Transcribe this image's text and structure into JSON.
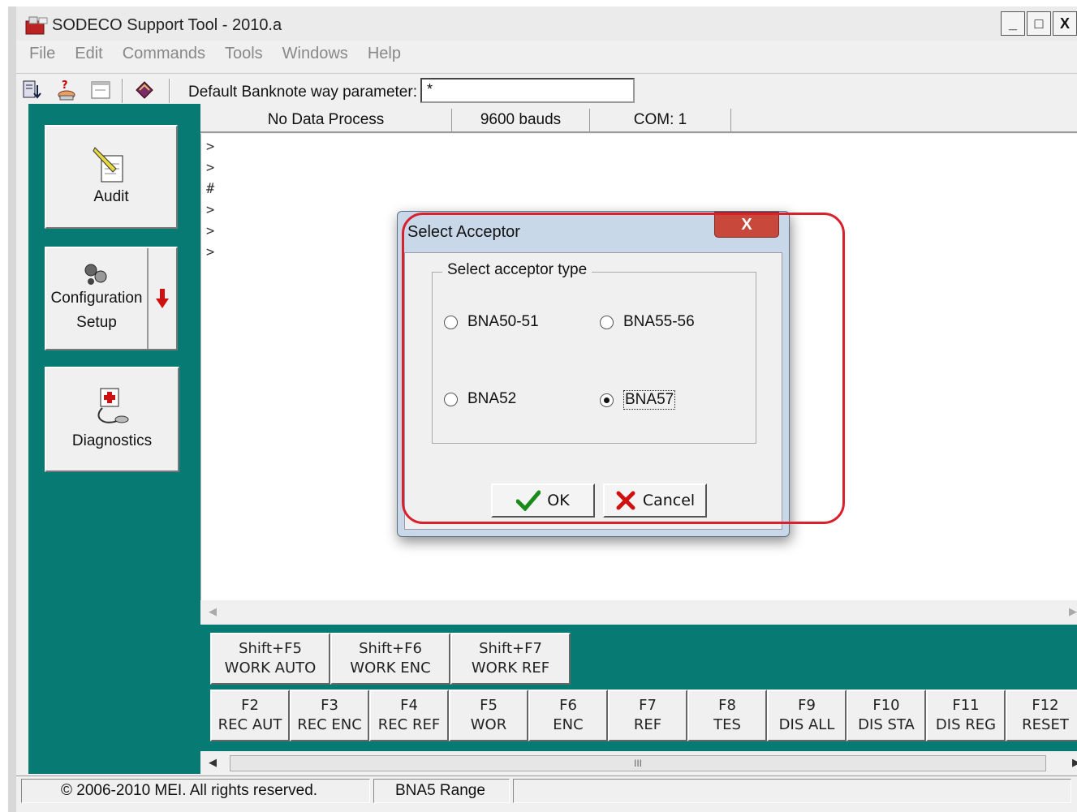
{
  "window": {
    "title": "SODECO Support Tool - 2010.a",
    "controls": [
      "_",
      "□",
      "X"
    ]
  },
  "menu": [
    "File",
    "Edit",
    "Commands",
    "Tools",
    "Windows",
    "Help"
  ],
  "toolbar": {
    "param_label": "Default Banknote way parameter:",
    "param_value": "*"
  },
  "sidebar": {
    "audit_label": "Audit",
    "config_label_1": "Configuration",
    "config_label_2": "Setup",
    "diagnostics_label": "Diagnostics"
  },
  "status_strip": {
    "process": "No Data Process",
    "bauds": "9600 bauds",
    "com": "COM: 1"
  },
  "console": {
    "lines": [
      ">",
      ">",
      "#",
      ">",
      ">",
      ">"
    ]
  },
  "fkeys_row1": [
    {
      "key": "Shift+F5",
      "label": "WORK AUTO"
    },
    {
      "key": "Shift+F6",
      "label": "WORK ENC"
    },
    {
      "key": "Shift+F7",
      "label": "WORK REF"
    }
  ],
  "fkeys_row2": [
    {
      "key": "F2",
      "label": "REC AUT"
    },
    {
      "key": "F3",
      "label": "REC ENC"
    },
    {
      "key": "F4",
      "label": "REC REF"
    },
    {
      "key": "F5",
      "label": "WOR"
    },
    {
      "key": "F6",
      "label": "ENC"
    },
    {
      "key": "F7",
      "label": "REF"
    },
    {
      "key": "F8",
      "label": "TES"
    },
    {
      "key": "F9",
      "label": "DIS ALL"
    },
    {
      "key": "F10",
      "label": "DIS STA"
    },
    {
      "key": "F11",
      "label": "DIS REG"
    },
    {
      "key": "F12",
      "label": "RESET"
    }
  ],
  "scroll_thumb_text": "III",
  "statusbar": {
    "copyright": "© 2006-2010 MEI. All rights reserved.",
    "range": "BNA5 Range"
  },
  "dialog": {
    "title": "Select Acceptor",
    "close": "X",
    "group_title": "Select acceptor type",
    "options": [
      "BNA50-51",
      "BNA55-56",
      "BNA52",
      "BNA57"
    ],
    "selected": "BNA57",
    "ok_label": "OK",
    "cancel_label": "Cancel"
  },
  "colors": {
    "teal_panel": "#087a74",
    "highlight_red": "#d9212d"
  }
}
